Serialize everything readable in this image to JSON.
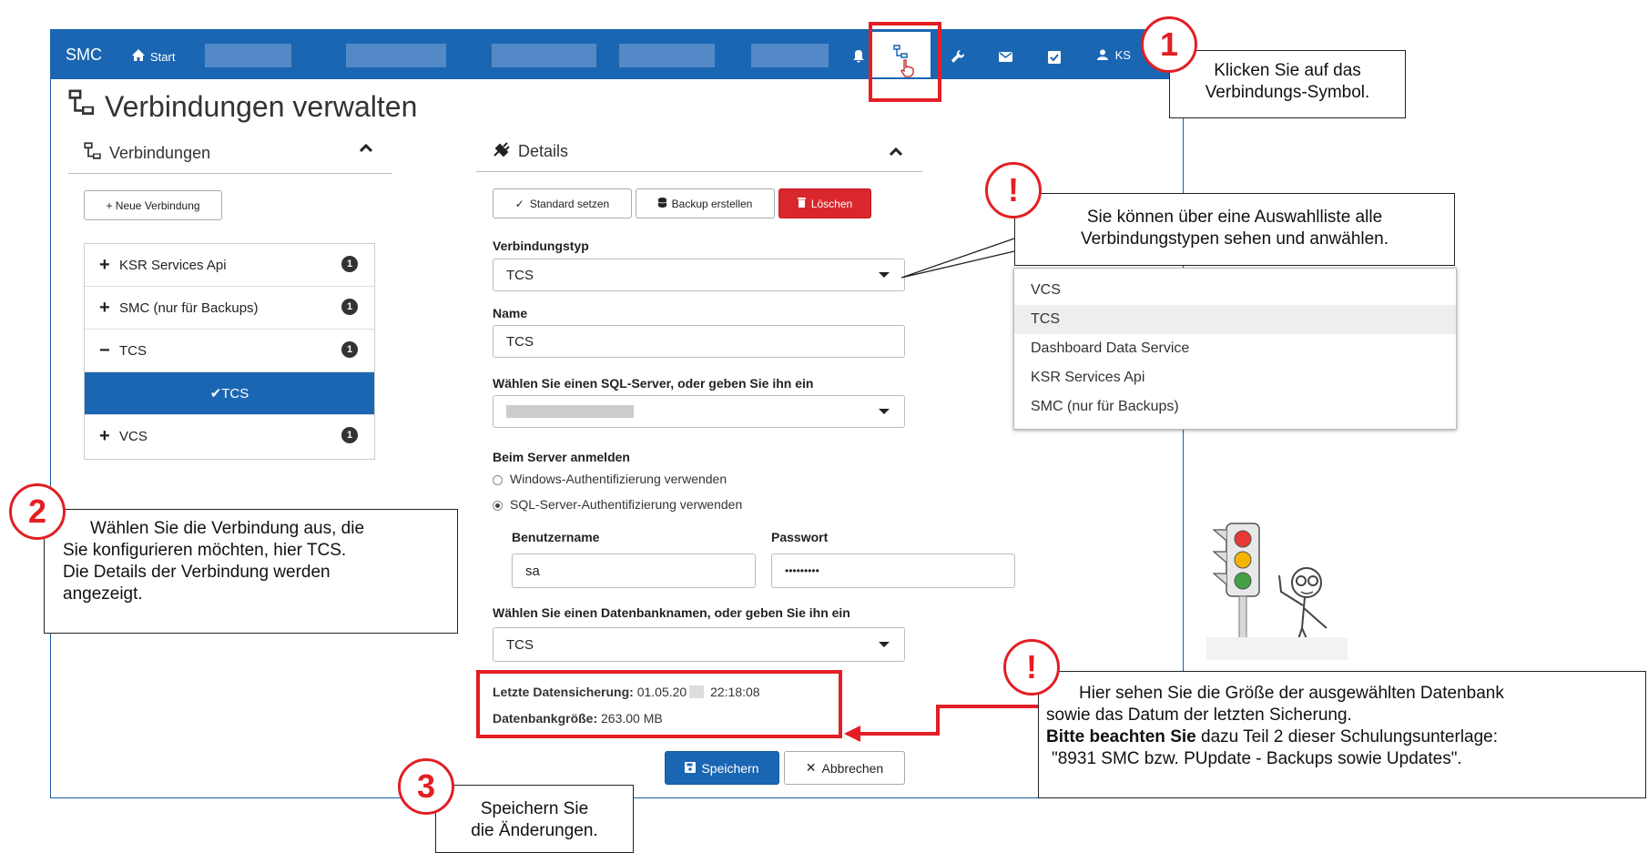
{
  "header": {
    "brand": "SMC",
    "start_label": "Start",
    "user_label": "KS"
  },
  "page": {
    "title": "Verbindungen verwalten"
  },
  "connections_panel": {
    "title": "Verbindungen",
    "new_button": "+ Neue Verbindung",
    "items": [
      {
        "sign": "+",
        "label": "KSR Services Api",
        "badge": "1"
      },
      {
        "sign": "+",
        "label": "SMC (nur für Backups)",
        "badge": "1"
      },
      {
        "sign": "−",
        "label": "TCS",
        "badge": "1"
      },
      {
        "sign": "",
        "label": "✔TCS",
        "badge": ""
      },
      {
        "sign": "+",
        "label": "VCS",
        "badge": "1"
      }
    ]
  },
  "details_panel": {
    "title": "Details",
    "buttons": {
      "set_default": "Standard setzen",
      "backup": "Backup erstellen",
      "delete": "Löschen"
    },
    "type_label": "Verbindungstyp",
    "type_value": "TCS",
    "name_label": "Name",
    "name_value": "TCS",
    "server_label": "Wählen Sie einen SQL-Server, oder geben Sie ihn ein",
    "login_label": "Beim Server anmelden",
    "radio_windows": "Windows-Authentifizierung verwenden",
    "radio_sql": "SQL-Server-Authentifizierung verwenden",
    "username_label": "Benutzername",
    "username_value": "sa",
    "password_label": "Passwort",
    "password_value": "•••••••••",
    "db_label": "Wählen Sie einen Datenbanknamen, oder geben Sie ihn ein",
    "db_value": "TCS",
    "last_backup_label": "Letzte Datensicherung:",
    "last_backup_date": "01.05.20",
    "last_backup_time": "22:18:08",
    "db_size_label": "Datenbankgröße:",
    "db_size_value": "263.00 MB",
    "save_button": "Speichern",
    "cancel_button": "Abbrechen"
  },
  "dropdown_options": [
    "VCS",
    "TCS",
    "Dashboard Data Service",
    "KSR Services Api",
    "SMC (nur für Backups)"
  ],
  "callouts": {
    "step1_number": "1",
    "step1_line1": "Klicken Sie auf das",
    "step1_line2": "Verbindungs-Symbol.",
    "note1_mark": "!",
    "note1_line1": "Sie können über eine Auswahlliste alle",
    "note1_line2": "Verbindungstypen sehen und anwählen.",
    "step2_number": "2",
    "step2_line1": "Wählen Sie die Verbindung aus, die",
    "step2_line2": "Sie konfigurieren möchten, hier TCS.",
    "step2_line3": "Die Details der Verbindung werden",
    "step2_line4": "angezeigt.",
    "note2_mark": "!",
    "note2_line1": "Hier sehen Sie die Größe der ausgewählten Datenbank",
    "note2_line2": "sowie das Datum der letzten Sicherung.",
    "note2_bold": "Bitte beachten Sie",
    "note2_line3_rest": " dazu Teil 2 dieser Schulungsunterlage:",
    "note2_line4": "\"8931 SMC bzw. PUpdate - Backups sowie Updates\".",
    "step3_number": "3",
    "step3_line1": "Speichern Sie",
    "step3_line2": "die Änderungen."
  },
  "colors": {
    "topbar": "#1b66b3",
    "accent_red": "#e31e24",
    "selected": "#1b66b3"
  }
}
